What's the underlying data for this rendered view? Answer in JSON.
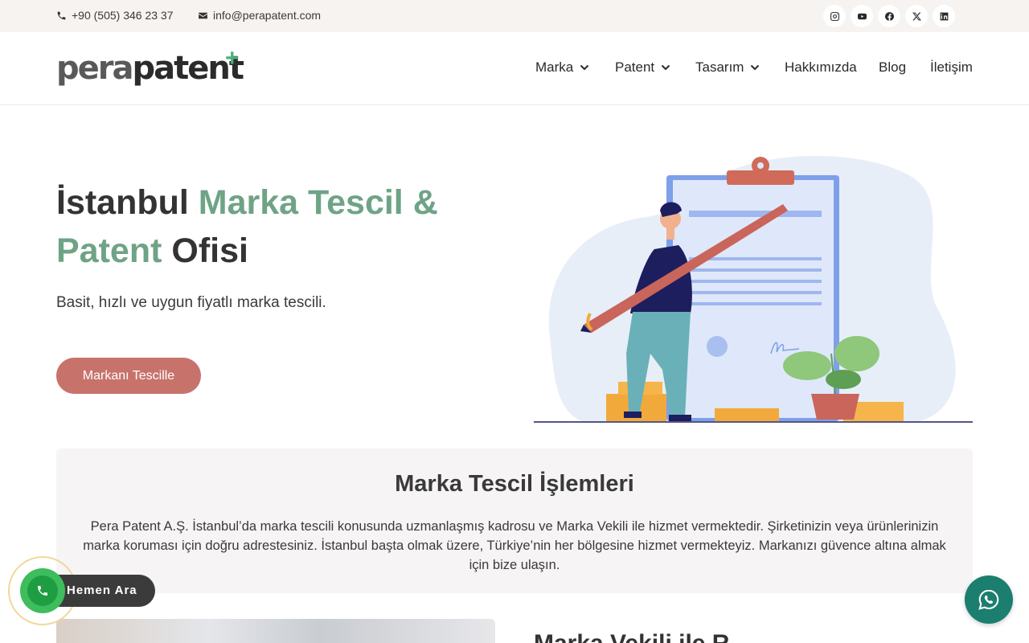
{
  "topbar": {
    "phone": "+90 (505) 346 23 37",
    "email": "info@perapatent.com",
    "social_icons": [
      "instagram-icon",
      "youtube-icon",
      "facebook-icon",
      "x-icon",
      "linkedin-icon"
    ]
  },
  "header": {
    "logo": {
      "part1": "pera",
      "part2": "patent",
      "plus": "+"
    },
    "nav": [
      {
        "label": "Marka",
        "has_dropdown": true
      },
      {
        "label": "Patent",
        "has_dropdown": true
      },
      {
        "label": "Tasarım",
        "has_dropdown": true
      },
      {
        "label": "Hakkımızda",
        "has_dropdown": false
      },
      {
        "label": "Blog",
        "has_dropdown": false
      },
      {
        "label": "İletişim",
        "has_dropdown": false
      }
    ]
  },
  "hero": {
    "title_part1": "İstanbul ",
    "title_accent1": "Marka Tescil & Patent",
    "title_part2": " Ofisi",
    "subtitle": "Basit, hızlı ve uygun fiyatlı marka tescili.",
    "cta_label": "Markanı Tescille"
  },
  "section": {
    "title": "Marka Tescil İşlemleri",
    "text": "Pera Patent A.Ş. İstanbul’da marka tescili konusunda uzmanlaşmış kadrosu ve Marka Vekili ile hizmet vermektedir. Şirketinizin veya ürünlerinizin marka koruması için doğru adrestesiniz. İstanbul başta olmak üzere, Türkiye’nin her bölgesine hizmet vermekteyiz. Markanızı güvence altına almak için bize ulaşın."
  },
  "next_section": {
    "heading_partial": "Marka Vekili ile R"
  },
  "floating": {
    "call_label": "Hemen Ara"
  },
  "colors": {
    "accent_green": "#6fa386",
    "cta": "#c7736c",
    "topbar_bg": "#f6f3f0",
    "whatsapp": "#1b7e6f",
    "call_green": "#3dbd5c"
  }
}
